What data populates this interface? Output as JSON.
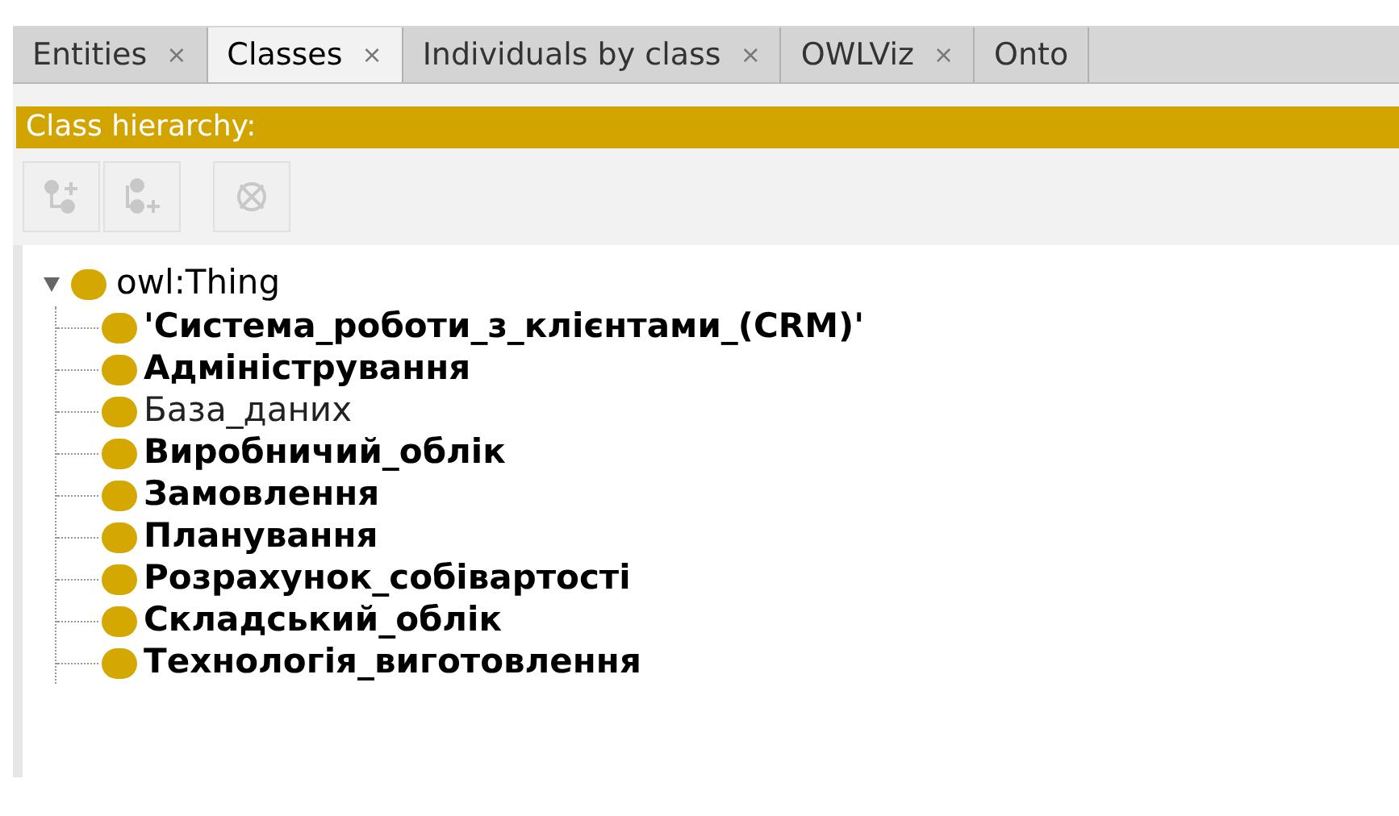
{
  "tabs": [
    {
      "label": "Entities",
      "close": "×",
      "selected": false
    },
    {
      "label": "Classes",
      "close": "×",
      "selected": true
    },
    {
      "label": "Individuals by class",
      "close": "×",
      "selected": false
    },
    {
      "label": "OWLViz",
      "close": "×",
      "selected": false
    },
    {
      "label": "Onto",
      "selected": false
    }
  ],
  "panel_title": "Class hierarchy:",
  "toolbar": [
    {
      "kind": "add-sub",
      "disabled": true
    },
    {
      "kind": "add-sibling",
      "disabled": true
    },
    {
      "kind": "delete",
      "disabled": true
    }
  ],
  "tree": [
    {
      "label": "owl:Thing",
      "bold": false,
      "expanded": true,
      "children": [
        {
          "label": "'Система_роботи_з_клієнтами_(CRM)'",
          "bold": true
        },
        {
          "label": "Адміністрування",
          "bold": true
        },
        {
          "label": "База_даних",
          "bold": false
        },
        {
          "label": "Виробничий_облік",
          "bold": true
        },
        {
          "label": "Замовлення",
          "bold": true
        },
        {
          "label": "Планування",
          "bold": true
        },
        {
          "label": "Розрахунок_собівартості",
          "bold": true
        },
        {
          "label": "Складський_облік",
          "bold": true
        },
        {
          "label": "Технологія_виготовлення",
          "bold": true
        }
      ]
    }
  ]
}
